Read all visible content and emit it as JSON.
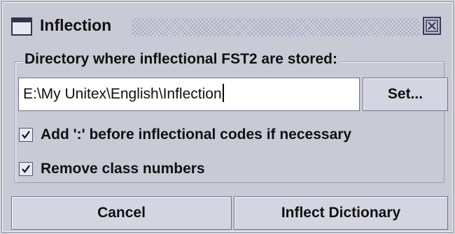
{
  "window": {
    "title": "Inflection",
    "icon": "window-icon",
    "close_icon": "close-icon"
  },
  "group": {
    "legend": "Directory where inflectional FST2 are stored:",
    "directory_value": "E:\\My Unitex\\English\\Inflection",
    "set_label": "Set..."
  },
  "options": [
    {
      "label": "Add ':' before inflectional codes if necessary",
      "checked": true
    },
    {
      "label": "Remove class numbers",
      "checked": true
    }
  ],
  "buttons": {
    "cancel_label": "Cancel",
    "inflect_label": "Inflect Dictionary"
  }
}
